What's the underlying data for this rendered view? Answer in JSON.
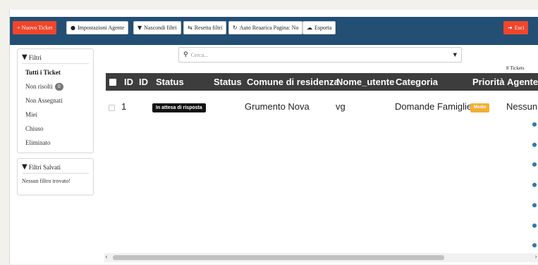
{
  "toolbar": {
    "new_ticket": "+ Nuovo Ticket",
    "agent_settings": "Impostazioni Agente",
    "hide_filters": "Nascondi filtri",
    "reset_filters": "Resetta filtri",
    "auto_refresh": "Auto Reaarica Pagina: No",
    "export": "Esporta",
    "logout": "Esci"
  },
  "icons": {
    "agent_settings": "users-gear-icon",
    "hide_filters": "filter-icon",
    "reset_filters": "retweet-icon",
    "auto_refresh": "refresh-icon",
    "export": "cloud-download-icon",
    "logout": "sign-out-icon"
  },
  "colors": {
    "topbar": "#234f74",
    "accent_red": "#f0462b",
    "header_dark": "#3d3d3d",
    "status_pill": "#111111",
    "priority_medium": "#f3ae35"
  },
  "filters": {
    "title": "Filtri",
    "items": [
      {
        "label": "Tutti i Ticket",
        "active": true
      },
      {
        "label": "Non risolti",
        "badge": "0"
      },
      {
        "label": "Non Assegnati"
      },
      {
        "label": "Miei"
      },
      {
        "label": "Chiuso"
      },
      {
        "label": "Eliminato"
      }
    ]
  },
  "saved_filters": {
    "title": "Filtri Salvati",
    "empty_text": "Nessun filtro trovato!"
  },
  "search": {
    "placeholder": "Cerca..."
  },
  "ticket_count": "8 Tickets",
  "table": {
    "columns": [
      "ID",
      "ID",
      "Status",
      "Status",
      "Comune di residenza",
      "Nome_utente",
      "Categoria",
      "Priorità",
      "Agente"
    ],
    "rows": [
      {
        "id": "1",
        "status": "In attesa di risposta",
        "comune": "Grumento Nova",
        "nome_utente": "vg",
        "categoria": "Domande Famiglie",
        "priorita": "Medio",
        "agente": "Nessun"
      }
    ]
  }
}
